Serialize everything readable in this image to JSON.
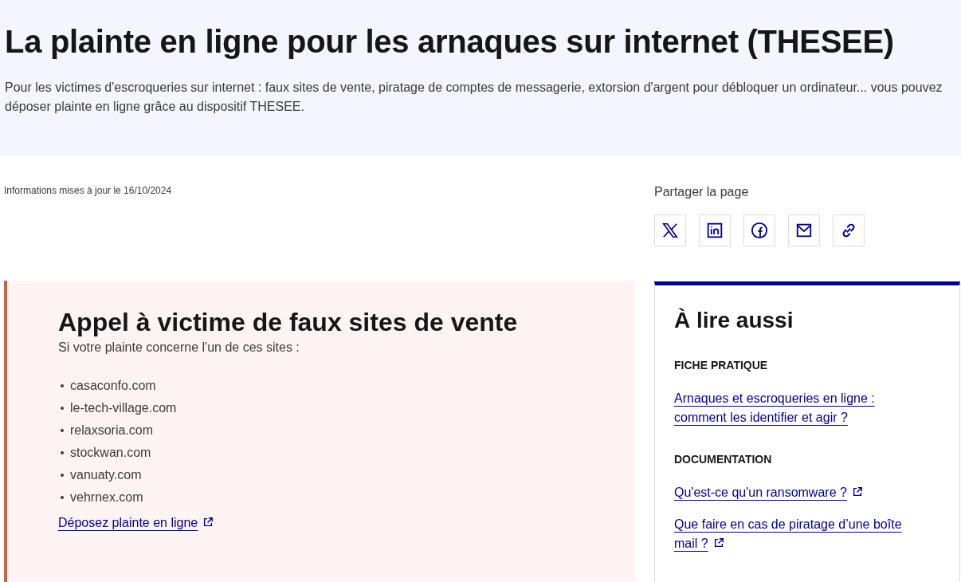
{
  "header": {
    "title": "La plainte en ligne pour les arnaques sur internet (THESEE)",
    "description": "Pour les victimes d'escroqueries sur internet :  faux sites de vente, piratage de comptes de messagerie, extorsion d'argent pour débloquer un ordinateur... vous pouvez déposer plainte en ligne grâce au dispositif THESEE."
  },
  "updated": "Informations mises à jour le 16/10/2024",
  "share": {
    "label": "Partager la page",
    "buttons": [
      {
        "kind": "x"
      },
      {
        "kind": "linkedin"
      },
      {
        "kind": "facebook"
      },
      {
        "kind": "email"
      },
      {
        "kind": "link"
      }
    ]
  },
  "alert": {
    "title": "Appel à victime de faux sites de vente",
    "intro": "Si votre plainte concerne l'un de ces sites :",
    "sites": [
      "casaconfo.com",
      "le-tech-village.com",
      "relaxsoria.com",
      "stockwan.com",
      "vanuaty.com",
      "vehrnex.com"
    ],
    "link": {
      "label": "Déposez plainte en ligne",
      "external": true
    }
  },
  "see_also": {
    "title": "À lire aussi",
    "sections": [
      {
        "label": "FICHE PRATIQUE",
        "links": [
          {
            "label": "Arnaques et escroqueries en ligne : comment les identifier et agir ?",
            "external": false
          }
        ]
      },
      {
        "label": "DOCUMENTATION",
        "links": [
          {
            "label": "Qu'est-ce qu'un ransomware ?",
            "external": true
          },
          {
            "label": "Que faire en cas de piratage d’une boîte mail ?",
            "external": true
          }
        ]
      }
    ]
  }
}
